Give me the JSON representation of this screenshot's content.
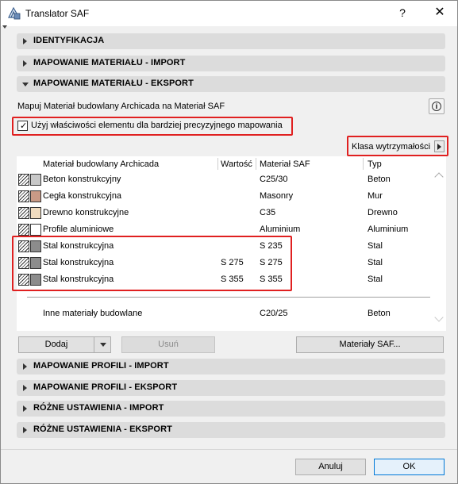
{
  "window": {
    "title": "Translator SAF",
    "help": "?",
    "close": "✕"
  },
  "sections_top": [
    {
      "label": "IDENTYFIKACJA",
      "expanded": false
    },
    {
      "label": "MAPOWANIE MATERIAŁU - IMPORT",
      "expanded": false
    },
    {
      "label": "MAPOWANIE MATERIAŁU - EKSPORT",
      "expanded": true
    }
  ],
  "export": {
    "description": "Mapuj Materiał budowlany Archicada na Materiał SAF",
    "info_icon": "i",
    "checkbox_label": "Użyj właściwości elementu dla bardziej precyzyjnego mapowania",
    "checkbox_checked": true,
    "klasa_label": "Klasa wytrzymałości"
  },
  "table": {
    "headers": [
      "Materiał budowlany Archicada",
      "Wartość",
      "Materiał SAF",
      "Typ"
    ],
    "rows": [
      {
        "material": "Beton konstrukcyjny",
        "value": "",
        "saf": "C25/30",
        "type": "Beton",
        "color": "#c8c8c8"
      },
      {
        "material": "Cegła konstrukcyjna",
        "value": "",
        "saf": "Masonry",
        "type": "Mur",
        "color": "#c99a86"
      },
      {
        "material": "Drewno konstrukcyjne",
        "value": "",
        "saf": "C35",
        "type": "Drewno",
        "color": "#f1dcc0"
      },
      {
        "material": "Profile aluminiowe",
        "value": "",
        "saf": "Aluminium",
        "type": "Aluminium",
        "color": "#ffffff"
      },
      {
        "material": "Stal konstrukcyjna",
        "value": "",
        "saf": "S 235",
        "type": "Stal",
        "color": "#8c8c8c"
      },
      {
        "material": "Stal konstrukcyjna",
        "value": "S 275",
        "saf": "S 275",
        "type": "Stal",
        "color": "#8c8c8c"
      },
      {
        "material": "Stal konstrukcyjna",
        "value": "S 355",
        "saf": "S 355",
        "type": "Stal",
        "color": "#8c8c8c"
      }
    ],
    "other": {
      "material": "Inne materiały budowlane",
      "saf": "C20/25",
      "type": "Beton"
    }
  },
  "actions": {
    "add": "Dodaj",
    "remove": "Usuń",
    "saf_materials": "Materiały SAF..."
  },
  "sections_bottom": [
    {
      "label": "MAPOWANIE PROFILI - IMPORT"
    },
    {
      "label": "MAPOWANIE PROFILI - EKSPORT"
    },
    {
      "label": "RÓŻNE USTAWIENIA - IMPORT"
    },
    {
      "label": "RÓŻNE USTAWIENIA - EKSPORT"
    }
  ],
  "footer": {
    "cancel": "Anuluj",
    "ok": "OK"
  },
  "colors": {
    "highlight": "#e02020",
    "ok_border": "#0078d7",
    "section_bg": "#dcdcdc"
  }
}
